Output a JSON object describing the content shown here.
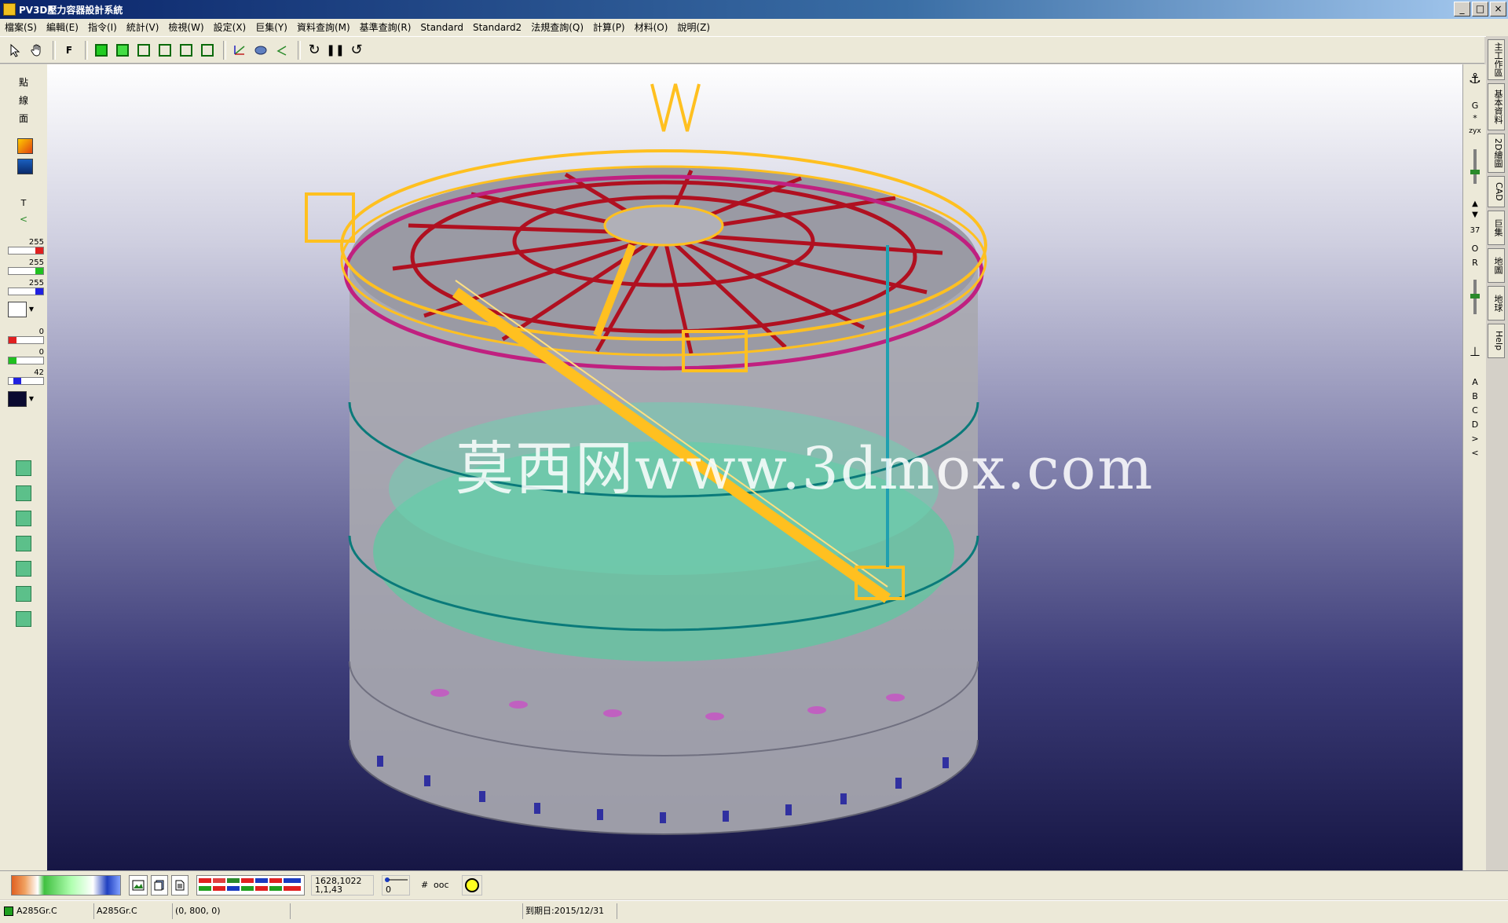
{
  "window": {
    "title": "PV3D壓力容器設計系統"
  },
  "menu": [
    "檔案(S)",
    "編輯(E)",
    "指令(I)",
    "統計(V)",
    "檢視(W)",
    "設定(X)",
    "巨集(Y)",
    "資料查詢(M)",
    "基準查詢(R)",
    "Standard",
    "Standard2",
    "法規查詢(Q)",
    "計算(P)",
    "材料(O)",
    "說明(Z)"
  ],
  "toolbar": {
    "f_label": "F"
  },
  "left_toolbar": {
    "labels": [
      "點",
      "線",
      "面"
    ],
    "t_label": "T",
    "rgb_top": [
      "255",
      "255",
      "255"
    ],
    "rgb_bottom": [
      "0",
      "0",
      "42"
    ]
  },
  "viewport": {
    "watermark": "莫西网www.3dmox.com"
  },
  "right_toolbar": {
    "g_label": "G",
    "star_label": "*",
    "xyz_label": "zyx",
    "zoom_value": "37",
    "o_label": "O",
    "r_label": "R",
    "letters": [
      "A",
      "B",
      "C",
      "D",
      ">",
      "<"
    ]
  },
  "side_tabs": [
    "主工作區",
    "基本資料",
    "2D繪圖",
    "CAD",
    "巨集",
    "地圖",
    "地球",
    "Help"
  ],
  "bottom_toolbar": {
    "coords_line1": "1628,1022",
    "coords_line2": "1,1,43",
    "slider_value": "0",
    "hash_label": "#",
    "ooc_label": "ooc"
  },
  "status": {
    "material1": "A285Gr.C",
    "material2": "A285Gr.C",
    "coords": "(0, 800, 0)",
    "expiry": "到期日:2015/12/31"
  },
  "colors": {
    "titlebar": "#0a246a",
    "handrail": "#ffc020",
    "rafter": "#b01020",
    "shell": "#a8a8b0",
    "floor": "#5fc8a0"
  }
}
